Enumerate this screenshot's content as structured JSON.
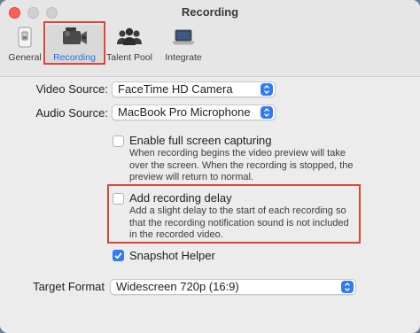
{
  "window": {
    "title": "Recording"
  },
  "tabs": [
    {
      "label": "General",
      "icon": "switch-icon",
      "selected": false
    },
    {
      "label": "Recording",
      "icon": "camcorder-icon",
      "selected": true
    },
    {
      "label": "Talent Pool",
      "icon": "people-icon",
      "selected": false
    },
    {
      "label": "Integrate",
      "icon": "laptop-icon",
      "selected": false
    }
  ],
  "video_source": {
    "label": "Video Source:",
    "value": "FaceTime HD Camera"
  },
  "audio_source": {
    "label": "Audio Source:",
    "value": "MacBook Pro Microphone"
  },
  "fullscreen": {
    "label": "Enable full screen capturing",
    "checked": false,
    "description": "When recording begins the video preview will take over the screen. When the recording is stopped, the preview will return to normal."
  },
  "delay": {
    "label": "Add recording delay",
    "checked": false,
    "description": "Add a slight delay to the start of each recording so that the recording notification sound is not included in the recorded video."
  },
  "snapshot": {
    "label": "Snapshot Helper",
    "checked": true
  },
  "target_format": {
    "label": "Target Format",
    "value": "Widescreen 720p (16:9)"
  },
  "colors": {
    "accent": "#2f7bf5",
    "highlight": "#d9453b"
  }
}
